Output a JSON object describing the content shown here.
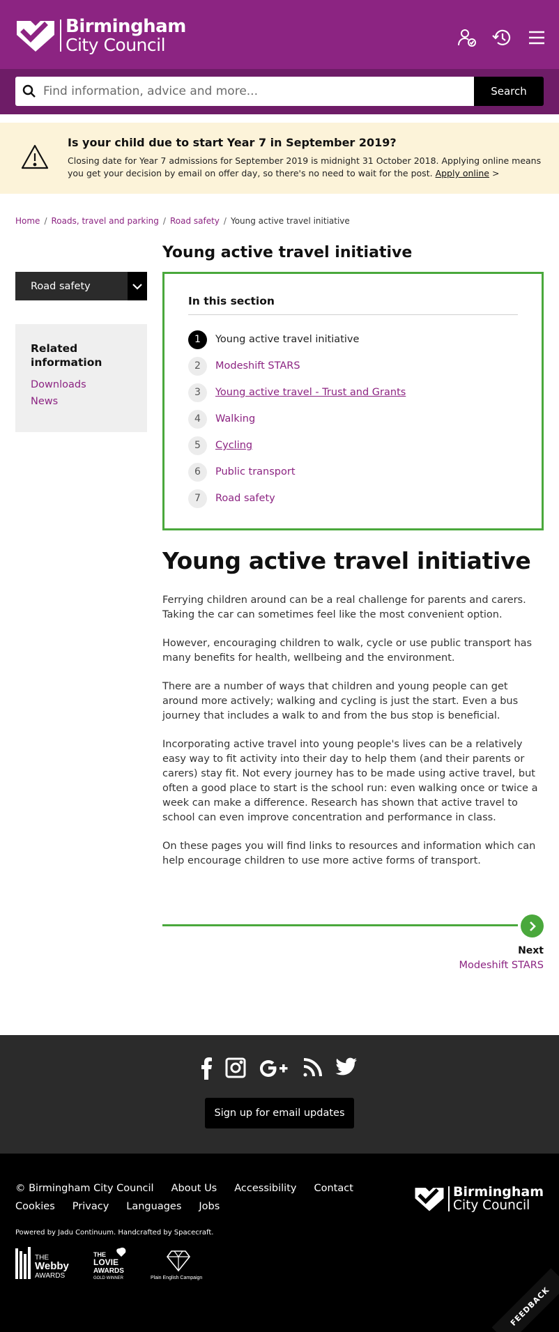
{
  "header": {
    "logo_line1": "Birmingham",
    "logo_line2": "City Council",
    "icons": [
      "account-icon",
      "history-icon",
      "menu-icon"
    ],
    "brand_color": "#8c2482"
  },
  "search": {
    "placeholder": "Find information, advice and more...",
    "button_label": "Search"
  },
  "alert": {
    "title": "Is your child due to start Year 7 in September 2019?",
    "body": "Closing date for Year 7 admissions for September 2019 is midnight 31 October 2018. Applying online means you get your decision by email on offer day, so there's no need to wait for the post.",
    "link_label": "Apply online",
    "link_suffix": ">"
  },
  "breadcrumb": {
    "items": [
      "Home",
      "Roads, travel and parking",
      "Road safety"
    ],
    "current": "Young active travel initiative",
    "separator": "/"
  },
  "sidebar": {
    "select_value": "Road safety",
    "related_title": "Related information",
    "related_links": [
      "Downloads",
      "News"
    ]
  },
  "main": {
    "page_title": "Young active travel initiative",
    "toc_title": "In this section",
    "toc": [
      {
        "num": "1",
        "label": "Young active travel initiative"
      },
      {
        "num": "2",
        "label": "Modeshift STARS"
      },
      {
        "num": "3",
        "label": "Young active travel - Trust and Grants"
      },
      {
        "num": "4",
        "label": "Walking"
      },
      {
        "num": "5",
        "label": "Cycling"
      },
      {
        "num": "6",
        "label": "Public transport"
      },
      {
        "num": "7",
        "label": "Road safety"
      }
    ],
    "heading": "Young active travel initiative",
    "paragraphs": [
      "Ferrying children around can be a real challenge for parents and carers. Taking the car can sometimes feel like the most convenient option.",
      "However, encouraging children to walk, cycle or use public transport has many benefits for health, wellbeing and the environment.",
      "There are a number of ways that children and young people can get around more actively; walking and cycling is just the start. Even a bus journey that includes a walk to and from the bus stop is beneficial.",
      "Incorporating active travel into young people's lives can be a relatively easy way to fit activity into their day to help them (and their parents or carers) stay fit. Not every journey has to be made using active travel, but often a good place to start is the school run: even walking once or twice a week can make a difference. Research has shown that active travel to school can even improve concentration and performance in class.",
      "On these pages you will find links to resources and information which can help encourage children to use more active forms of transport."
    ],
    "next_label": "Next",
    "next_link": "Modeshift STARS",
    "accent_color": "#4aa83c"
  },
  "footer": {
    "social_icons": [
      "facebook-icon",
      "instagram-icon",
      "google-plus-icon",
      "rss-icon",
      "twitter-icon"
    ],
    "signup_label": "Sign up for email updates",
    "links": [
      "© Birmingham City Council",
      "About Us",
      "Accessibility",
      "Contact",
      "Cookies",
      "Privacy",
      "Languages",
      "Jobs"
    ],
    "powered_by": "Powered by Jadu Continuum. Handcrafted by Spacecraft.",
    "award_logos": [
      "webby-awards-logo",
      "lovie-awards-logo",
      "plain-english-campaign-logo"
    ],
    "award_text": {
      "webby_line1": "THE",
      "webby_line2": "Webby",
      "webby_line3": "AWARDS",
      "lovie_line1": "THE",
      "lovie_line2": "LOVIE",
      "lovie_line3": "AWARDS",
      "lovie_line4": "GOLD WINNER",
      "plain_english": "Plain English Campaign"
    },
    "logo_line1": "Birmingham",
    "logo_line2": "City Council",
    "feedback_label": "FEEDBACK"
  }
}
